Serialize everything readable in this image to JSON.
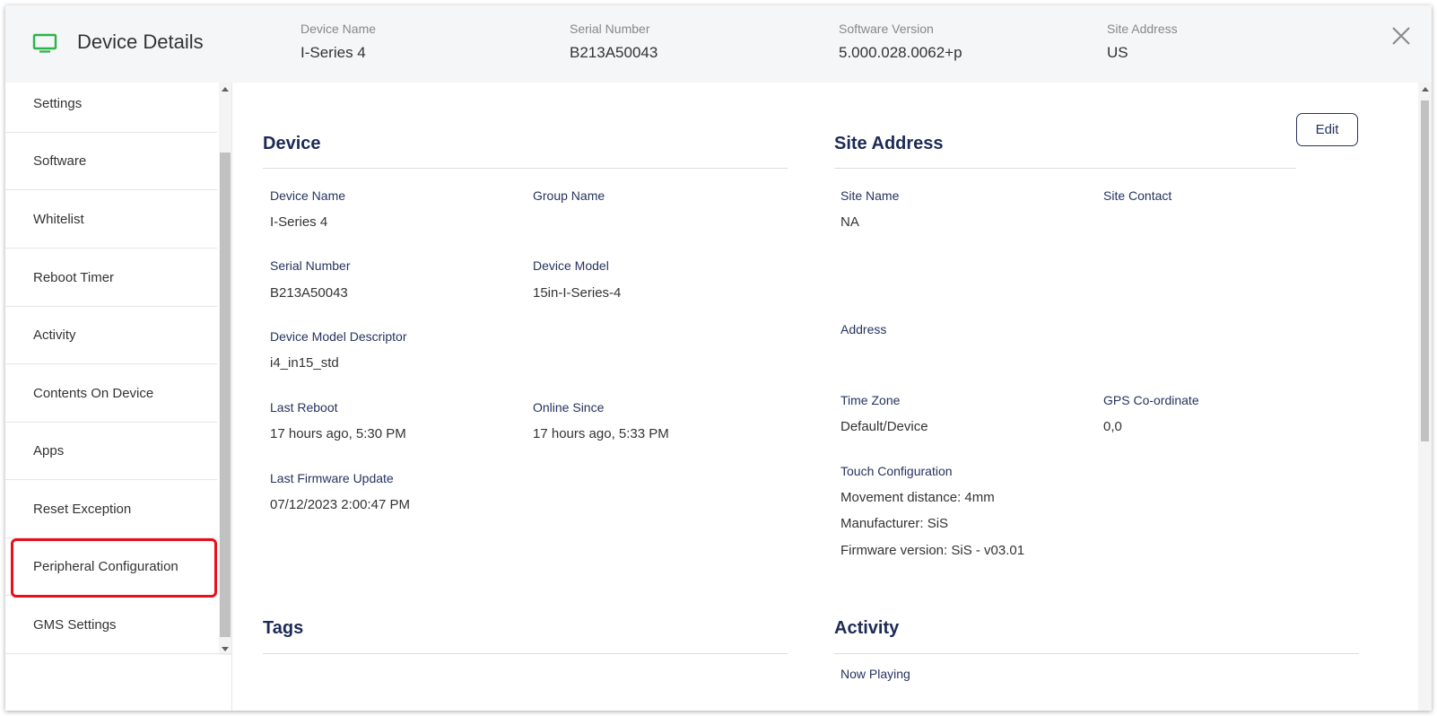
{
  "header": {
    "title": "Device Details",
    "meta": [
      {
        "label": "Device Name",
        "value": "I-Series 4"
      },
      {
        "label": "Serial Number",
        "value": "B213A50043"
      },
      {
        "label": "Software Version",
        "value": "5.000.028.0062+p"
      },
      {
        "label": "Site Address",
        "value": "US"
      }
    ]
  },
  "sidebar": {
    "items": [
      {
        "label": "Settings"
      },
      {
        "label": "Software"
      },
      {
        "label": "Whitelist"
      },
      {
        "label": "Reboot Timer"
      },
      {
        "label": "Activity"
      },
      {
        "label": "Contents On Device"
      },
      {
        "label": "Apps"
      },
      {
        "label": "Reset Exception"
      },
      {
        "label": "Peripheral Configuration"
      },
      {
        "label": "GMS Settings"
      }
    ]
  },
  "device": {
    "title": "Device",
    "device_name_label": "Device Name",
    "device_name": "I-Series 4",
    "group_name_label": "Group Name",
    "group_name": "",
    "serial_number_label": "Serial Number",
    "serial_number": "B213A50043",
    "device_model_label": "Device Model",
    "device_model": "15in-I-Series-4",
    "model_descriptor_label": "Device Model Descriptor",
    "model_descriptor": "i4_in15_std",
    "last_reboot_label": "Last Reboot",
    "last_reboot": "17 hours ago, 5:30 PM",
    "online_since_label": "Online Since",
    "online_since": "17 hours ago, 5:33 PM",
    "last_firmware_label": "Last Firmware Update",
    "last_firmware": "07/12/2023 2:00:47 PM"
  },
  "site": {
    "title": "Site Address",
    "edit_label": "Edit",
    "site_name_label": "Site Name",
    "site_name": "NA",
    "site_contact_label": "Site Contact",
    "address_label": "Address",
    "time_zone_label": "Time Zone",
    "time_zone": "Default/Device",
    "gps_label": "GPS Co-ordinate",
    "gps": "0,0",
    "touch_label": "Touch Configuration",
    "touch_movement": "Movement distance: 4mm",
    "touch_manufacturer": "Manufacturer: SiS",
    "touch_firmware": "Firmware version: SiS - v03.01"
  },
  "tags": {
    "title": "Tags"
  },
  "activity": {
    "title": "Activity",
    "now_playing_label": "Now Playing"
  },
  "colors": {
    "accent": "#1c2a55",
    "icon_green": "#2db34a",
    "highlight_red": "#e8101a"
  }
}
